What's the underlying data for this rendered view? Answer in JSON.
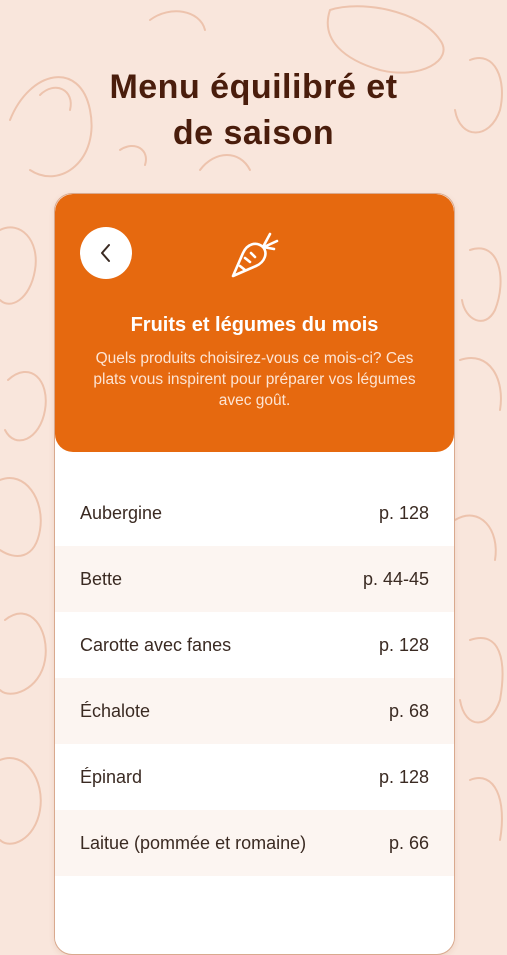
{
  "headline": {
    "line1": "Menu équilibré et",
    "line2": "de saison"
  },
  "card": {
    "back_icon": "chevron-left-icon",
    "category_icon": "carrot-icon",
    "title": "Fruits et légumes du mois",
    "subtitle": "Quels produits choisirez-vous ce mois-ci? Ces plats vous inspirent pour préparer vos légumes avec goût."
  },
  "items": [
    {
      "name": "Aubergine",
      "page": "p. 128"
    },
    {
      "name": "Bette",
      "page": "p. 44-45"
    },
    {
      "name": "Carotte avec fanes",
      "page": "p. 128"
    },
    {
      "name": "Échalote",
      "page": "p. 68"
    },
    {
      "name": "Épinard",
      "page": "p. 128"
    },
    {
      "name": "Laitue (pommée et romaine)",
      "page": "p. 66"
    }
  ],
  "colors": {
    "background": "#f9e6dc",
    "accent": "#e6690f",
    "headline": "#4a1d0c"
  }
}
